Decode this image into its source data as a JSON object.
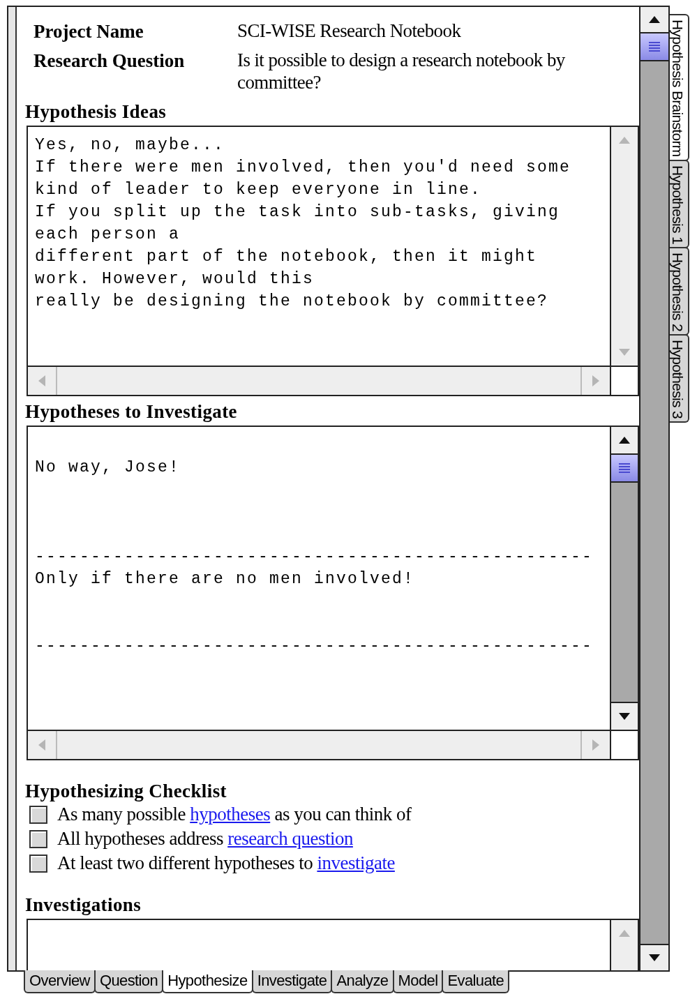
{
  "project_fields": [
    {
      "label": "Project Name",
      "value": "SCI-WISE Research Notebook"
    },
    {
      "label": "Research Question",
      "value": "Is it possible to design a research notebook by committee?"
    }
  ],
  "sections": [
    {
      "kind": "textbox",
      "title": "Hypothesis Ideas",
      "scrollable": false,
      "text": "Yes, no, maybe...\nIf there were men involved, then you'd need some\nkind of leader to keep everyone in line.\nIf you split up the task into sub-tasks, giving\neach person a\ndifferent part of the notebook, then it might\nwork. However, would this\nreally be designing the notebook by committee?"
    },
    {
      "kind": "textbox",
      "title": "Hypotheses to Investigate",
      "scrollable": true,
      "text": "\nNo way, Jose!\n\n\n\n--------------------------------------------------\nOnly if there are no men involved!\n\n\n--------------------------------------------------"
    },
    {
      "kind": "checklist",
      "title": "Hypothesizing Checklist",
      "items": [
        {
          "before": "As many possible ",
          "link": "hypotheses",
          "after": " as you can think of",
          "checked": false
        },
        {
          "before": "All hypotheses address ",
          "link": "research question",
          "checked": false
        },
        {
          "before": "At least two different hypotheses to ",
          "link": "investigate",
          "checked": false
        }
      ]
    },
    {
      "kind": "textbox",
      "title": "Investigations",
      "scrollable": false
    }
  ],
  "side_tabs": [
    {
      "label": "Hypothesis Brainstorm",
      "selected": true
    },
    {
      "label": "Hypothesis 1",
      "selected": false
    },
    {
      "label": "Hypothesis 2",
      "selected": false
    },
    {
      "label": "Hypothesis 3",
      "selected": false
    }
  ],
  "bottom_tabs": [
    {
      "label": "Overview",
      "selected": false
    },
    {
      "label": "Question",
      "selected": false
    },
    {
      "label": "Hypothesize",
      "selected": true
    },
    {
      "label": "Investigate",
      "selected": false
    },
    {
      "label": "Analyze",
      "selected": false
    },
    {
      "label": "Model",
      "selected": false
    },
    {
      "label": "Evaluate",
      "selected": false
    }
  ]
}
